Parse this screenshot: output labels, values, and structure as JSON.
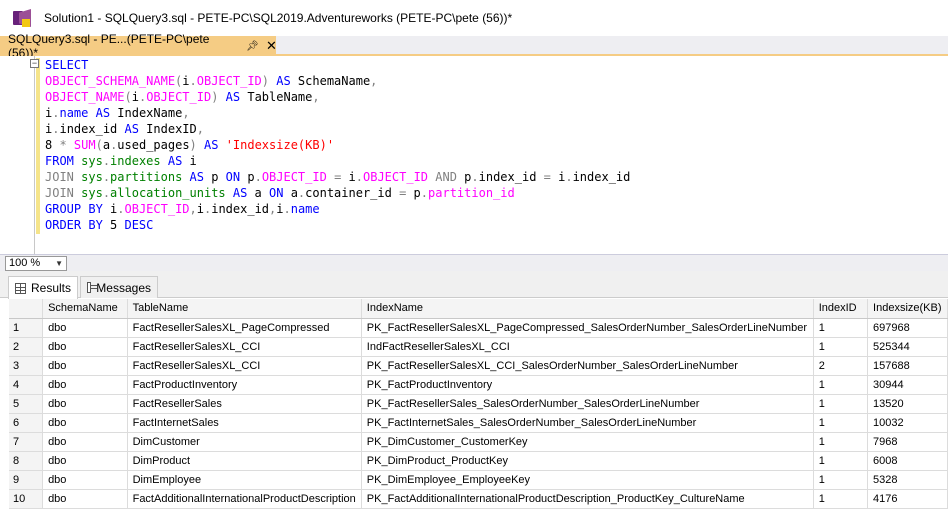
{
  "window": {
    "title": "Solution1 - SQLQuery3.sql - PETE-PC\\SQL2019.Adventureworks (PETE-PC\\pete (56))*"
  },
  "document_tab": {
    "label": "SQLQuery3.sql - PE...(PETE-PC\\pete (56))*",
    "pin_icon": "pin-icon",
    "close_icon": "close-icon"
  },
  "editor": {
    "lines": [
      [
        {
          "t": "SELECT",
          "c": "kw"
        }
      ],
      [
        {
          "t": "OBJECT_SCHEMA_NAME",
          "c": "fn"
        },
        {
          "t": "(",
          "c": "op"
        },
        {
          "t": "i",
          "c": "pl"
        },
        {
          "t": ".",
          "c": "op"
        },
        {
          "t": "OBJECT_ID",
          "c": "fn"
        },
        {
          "t": ")",
          "c": "op"
        },
        {
          "t": " AS ",
          "c": "kw"
        },
        {
          "t": "SchemaName",
          "c": "pl"
        },
        {
          "t": ",",
          "c": "op"
        }
      ],
      [
        {
          "t": "OBJECT_NAME",
          "c": "fn"
        },
        {
          "t": "(",
          "c": "op"
        },
        {
          "t": "i",
          "c": "pl"
        },
        {
          "t": ".",
          "c": "op"
        },
        {
          "t": "OBJECT_ID",
          "c": "fn"
        },
        {
          "t": ")",
          "c": "op"
        },
        {
          "t": " AS ",
          "c": "kw"
        },
        {
          "t": "TableName",
          "c": "pl"
        },
        {
          "t": ",",
          "c": "op"
        }
      ],
      [
        {
          "t": "i",
          "c": "pl"
        },
        {
          "t": ".",
          "c": "op"
        },
        {
          "t": "name",
          "c": "kw"
        },
        {
          "t": " AS ",
          "c": "kw"
        },
        {
          "t": "IndexName",
          "c": "pl"
        },
        {
          "t": ",",
          "c": "op"
        }
      ],
      [
        {
          "t": "i",
          "c": "pl"
        },
        {
          "t": ".",
          "c": "op"
        },
        {
          "t": "index_id",
          "c": "pl"
        },
        {
          "t": " AS ",
          "c": "kw"
        },
        {
          "t": "IndexID",
          "c": "pl"
        },
        {
          "t": ",",
          "c": "op"
        }
      ],
      [
        {
          "t": "8 ",
          "c": "pl"
        },
        {
          "t": "*",
          "c": "op"
        },
        {
          "t": " SUM",
          "c": "fn"
        },
        {
          "t": "(",
          "c": "op"
        },
        {
          "t": "a",
          "c": "pl"
        },
        {
          "t": ".",
          "c": "op"
        },
        {
          "t": "used_pages",
          "c": "pl"
        },
        {
          "t": ")",
          "c": "op"
        },
        {
          "t": " AS ",
          "c": "kw"
        },
        {
          "t": "'Indexsize(KB)'",
          "c": "str"
        }
      ],
      [
        {
          "t": "FROM ",
          "c": "kw"
        },
        {
          "t": "sys",
          "c": "sysobj"
        },
        {
          "t": ".",
          "c": "op"
        },
        {
          "t": "indexes",
          "c": "sysobj"
        },
        {
          "t": " AS ",
          "c": "kw"
        },
        {
          "t": "i",
          "c": "pl"
        }
      ],
      [
        {
          "t": "JOIN ",
          "c": "op"
        },
        {
          "t": "sys",
          "c": "sysobj"
        },
        {
          "t": ".",
          "c": "op"
        },
        {
          "t": "partitions",
          "c": "sysobj"
        },
        {
          "t": " AS ",
          "c": "kw"
        },
        {
          "t": "p ",
          "c": "pl"
        },
        {
          "t": "ON ",
          "c": "kw"
        },
        {
          "t": "p",
          "c": "pl"
        },
        {
          "t": ".",
          "c": "op"
        },
        {
          "t": "OBJECT_ID",
          "c": "fn"
        },
        {
          "t": " = ",
          "c": "op"
        },
        {
          "t": "i",
          "c": "pl"
        },
        {
          "t": ".",
          "c": "op"
        },
        {
          "t": "OBJECT_ID",
          "c": "fn"
        },
        {
          "t": " AND ",
          "c": "op"
        },
        {
          "t": "p",
          "c": "pl"
        },
        {
          "t": ".",
          "c": "op"
        },
        {
          "t": "index_id",
          "c": "pl"
        },
        {
          "t": " = ",
          "c": "op"
        },
        {
          "t": "i",
          "c": "pl"
        },
        {
          "t": ".",
          "c": "op"
        },
        {
          "t": "index_id",
          "c": "pl"
        }
      ],
      [
        {
          "t": "JOIN ",
          "c": "op"
        },
        {
          "t": "sys",
          "c": "sysobj"
        },
        {
          "t": ".",
          "c": "op"
        },
        {
          "t": "allocation_units",
          "c": "sysobj"
        },
        {
          "t": " AS ",
          "c": "kw"
        },
        {
          "t": "a ",
          "c": "pl"
        },
        {
          "t": "ON ",
          "c": "kw"
        },
        {
          "t": "a",
          "c": "pl"
        },
        {
          "t": ".",
          "c": "op"
        },
        {
          "t": "container_id",
          "c": "pl"
        },
        {
          "t": " = ",
          "c": "op"
        },
        {
          "t": "p",
          "c": "pl"
        },
        {
          "t": ".",
          "c": "op"
        },
        {
          "t": "partition_id",
          "c": "fn"
        }
      ],
      [
        {
          "t": "GROUP BY ",
          "c": "kw"
        },
        {
          "t": "i",
          "c": "pl"
        },
        {
          "t": ".",
          "c": "op"
        },
        {
          "t": "OBJECT_ID",
          "c": "fn"
        },
        {
          "t": ",",
          "c": "op"
        },
        {
          "t": "i",
          "c": "pl"
        },
        {
          "t": ".",
          "c": "op"
        },
        {
          "t": "index_id",
          "c": "pl"
        },
        {
          "t": ",",
          "c": "op"
        },
        {
          "t": "i",
          "c": "pl"
        },
        {
          "t": ".",
          "c": "op"
        },
        {
          "t": "name",
          "c": "kw"
        }
      ],
      [
        {
          "t": "ORDER BY ",
          "c": "kw"
        },
        {
          "t": "5 ",
          "c": "pl"
        },
        {
          "t": "DESC",
          "c": "kw"
        }
      ]
    ]
  },
  "zoom": {
    "value": "100 %"
  },
  "results_tabs": {
    "results": "Results",
    "messages": "Messages"
  },
  "grid": {
    "columns": [
      "SchemaName",
      "TableName",
      "IndexName",
      "IndexID",
      "Indexsize(KB)"
    ],
    "rows": [
      [
        "1",
        "dbo",
        "FactResellerSalesXL_PageCompressed",
        "PK_FactResellerSalesXL_PageCompressed_SalesOrderNumber_SalesOrderLineNumber",
        "1",
        "697968"
      ],
      [
        "2",
        "dbo",
        "FactResellerSalesXL_CCI",
        "IndFactResellerSalesXL_CCI",
        "1",
        "525344"
      ],
      [
        "3",
        "dbo",
        "FactResellerSalesXL_CCI",
        "PK_FactResellerSalesXL_CCI_SalesOrderNumber_SalesOrderLineNumber",
        "2",
        "157688"
      ],
      [
        "4",
        "dbo",
        "FactProductInventory",
        "PK_FactProductInventory",
        "1",
        "30944"
      ],
      [
        "5",
        "dbo",
        "FactResellerSales",
        "PK_FactResellerSales_SalesOrderNumber_SalesOrderLineNumber",
        "1",
        "13520"
      ],
      [
        "6",
        "dbo",
        "FactInternetSales",
        "PK_FactInternetSales_SalesOrderNumber_SalesOrderLineNumber",
        "1",
        "10032"
      ],
      [
        "7",
        "dbo",
        "DimCustomer",
        "PK_DimCustomer_CustomerKey",
        "1",
        "7968"
      ],
      [
        "8",
        "dbo",
        "DimProduct",
        "PK_DimProduct_ProductKey",
        "1",
        "6008"
      ],
      [
        "9",
        "dbo",
        "DimEmployee",
        "PK_DimEmployee_EmployeeKey",
        "1",
        "5328"
      ],
      [
        "10",
        "dbo",
        "FactAdditionalInternationalProductDescription",
        "PK_FactAdditionalInternationalProductDescription_ProductKey_CultureName",
        "1",
        "4176"
      ]
    ]
  }
}
